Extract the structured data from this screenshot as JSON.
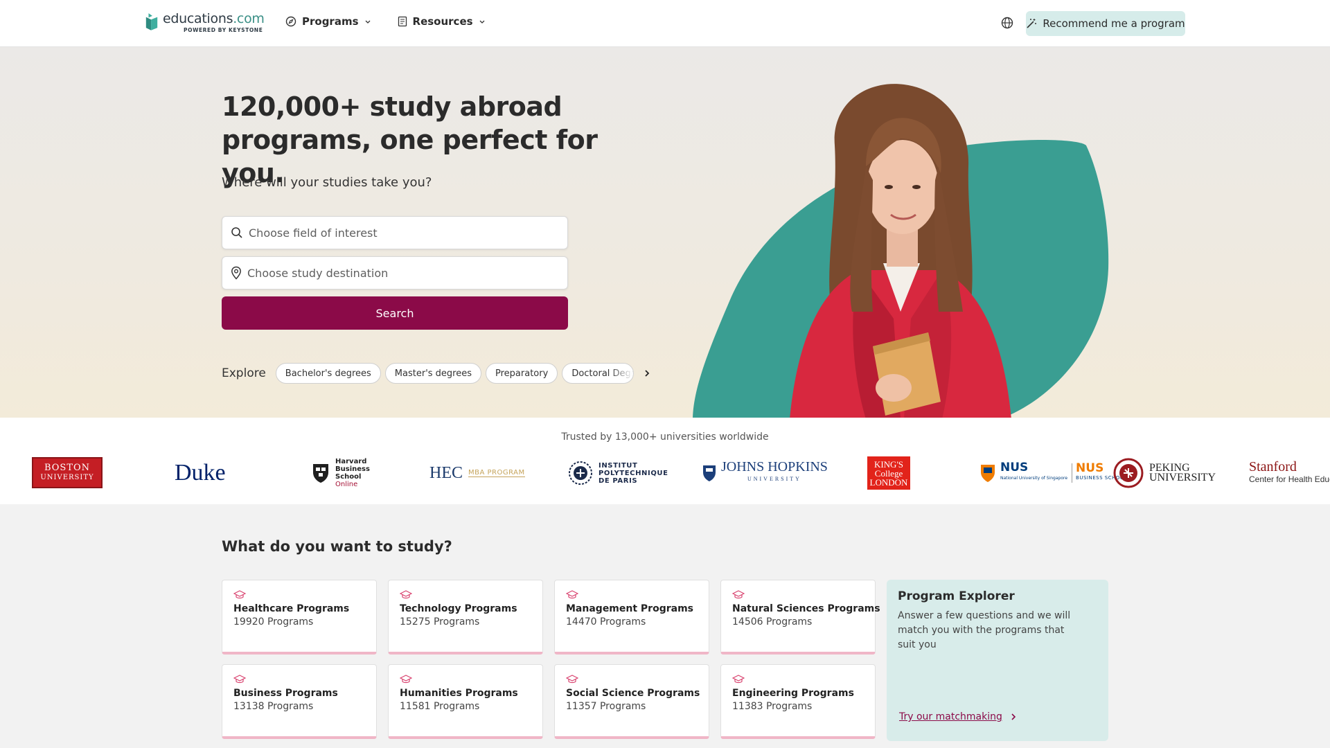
{
  "header": {
    "logo_name": "educations",
    "logo_tld": ".com",
    "logo_sub": "POWERED BY KEYSTONE",
    "nav": [
      {
        "label": "Programs"
      },
      {
        "label": "Resources"
      }
    ],
    "recommend_label": "Recommend me a program"
  },
  "hero": {
    "title": "120,000+ study abroad programs, one perfect for you.",
    "subtitle": "Where will your studies take you?",
    "field_placeholder": "Choose field of interest",
    "destination_placeholder": "Choose study destination",
    "search_label": "Search",
    "explore_label": "Explore",
    "chips": [
      "Bachelor's degrees",
      "Master's degrees",
      "Preparatory",
      "Doctoral Degrees"
    ]
  },
  "trusted": {
    "title": "Trusted by 13,000+ universities worldwide",
    "logos": {
      "bu_line1": "BOSTON",
      "bu_line2": "UNIVERSITY",
      "duke": "Duke",
      "hbs_l1": "Harvard",
      "hbs_l2": "Business",
      "hbs_l3": "School",
      "hbs_l4": "Online",
      "hec": "HEC",
      "hec_mba": "MBA PROGRAM",
      "ipp_l1": "INSTITUT",
      "ipp_l2": "POLYTECHNIQUE",
      "ipp_l3": "DE PARIS",
      "jh_main": "JOHNS HOPKINS",
      "jh_sub": "UNIVERSITY",
      "kcl_l1": "KING'S",
      "kcl_l2": "College",
      "kcl_l3": "LONDON",
      "nus_main": "NUS",
      "nus_sub": "National University of Singapore",
      "nusbs_main": "NUS",
      "nusbs_sub": "BUSINESS SCHOOL",
      "pku_l1": "PEKING",
      "pku_l2": "UNIVERSITY",
      "stan_main": "Stanford",
      "stan_sub": "Center for Health Education"
    }
  },
  "study": {
    "title": "What do you want to study?",
    "cards": [
      {
        "name": "Healthcare Programs",
        "count": "19920 Programs"
      },
      {
        "name": "Technology Programs",
        "count": "15275 Programs"
      },
      {
        "name": "Management Programs",
        "count": "14470 Programs"
      },
      {
        "name": "Natural Sciences Programs",
        "count": "14506 Programs"
      },
      {
        "name": "Business Programs",
        "count": "13138 Programs"
      },
      {
        "name": "Humanities Programs",
        "count": "11581 Programs"
      },
      {
        "name": "Social Science Programs",
        "count": "11357 Programs"
      },
      {
        "name": "Engineering Programs",
        "count": "11383 Programs"
      }
    ],
    "explorer": {
      "title": "Program Explorer",
      "description": "Answer a few questions and we will match you with the programs that suit you",
      "link": "Try our matchmaking"
    }
  },
  "colors": {
    "brand_primary": "#8b0a48",
    "accent_teal": "#3a9e92",
    "card_border": "#f0b6c7"
  }
}
